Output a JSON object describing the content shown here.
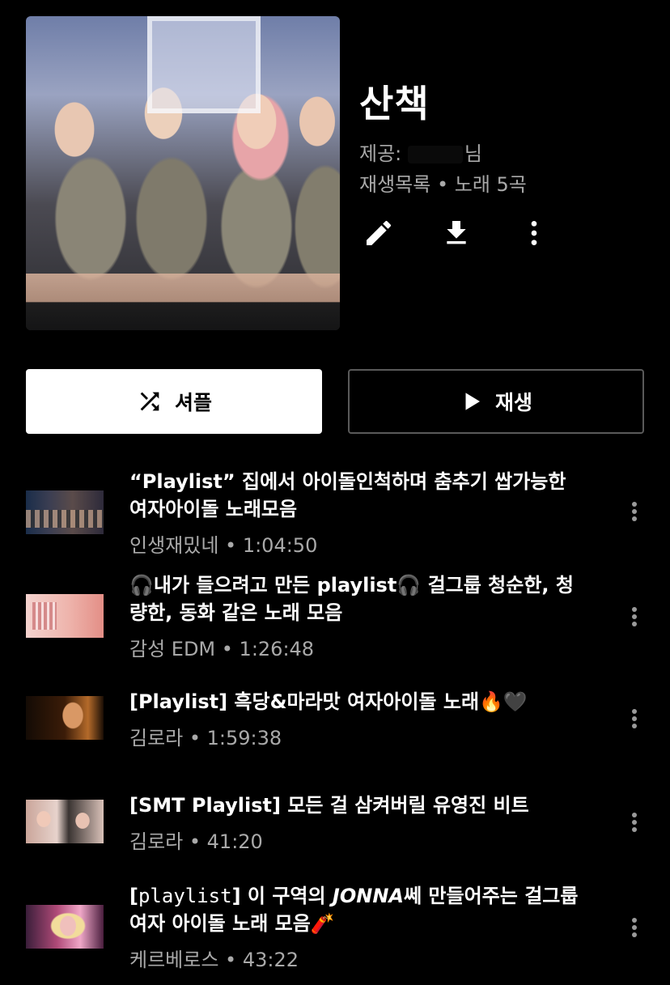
{
  "playlist": {
    "title": "산책",
    "provider_prefix": "제공:",
    "provider_suffix": "님",
    "type_line": "재생목록 • 노래 5곡"
  },
  "actions": {
    "shuffle_label": "셔플",
    "play_label": "재생",
    "edit_icon": "pencil-icon",
    "download_icon": "download-icon",
    "more_icon": "more-vert-icon"
  },
  "songs": [
    {
      "title": "“Playlist” 집에서 아이돌인척하며 춤추기 쌉가능한 여자아이돌 노래모음",
      "subtitle": "인생재밌네 • 1:04:50"
    },
    {
      "title_emoji_start": "🎧",
      "title_main": "내가 들으려고 만든 playlist",
      "title_emoji_mid": "🎧",
      "title_rest": " 걸그룹 청순한, 청량한, 동화 같은 노래 모음",
      "subtitle": "감성 EDM • 1:26:48"
    },
    {
      "title": "[Playlist] 흑당&마라맛 여자아이돌 노래",
      "title_emoji": "🔥🖤",
      "subtitle": "김로라 • 1:59:38"
    },
    {
      "title": "[SMT Playlist] 모든 걸 삼켜버릴 유영진 비트",
      "subtitle": "김로라 • 41:20"
    },
    {
      "title_open": "[",
      "title_mono": "playlist",
      "title_mid": "] 이 구역의 ",
      "title_italic": "JONNA",
      "title_rest": "쎄 만들어주는 걸그룹 여자 아이돌 노래 모음",
      "title_emoji": "🧨",
      "subtitle": "케르베로스 • 43:22"
    }
  ],
  "colors": {
    "background": "#000000",
    "secondary_text": "#a9a9a9",
    "shuffle_bg": "#ffffff",
    "play_border": "#5a5a5a"
  }
}
